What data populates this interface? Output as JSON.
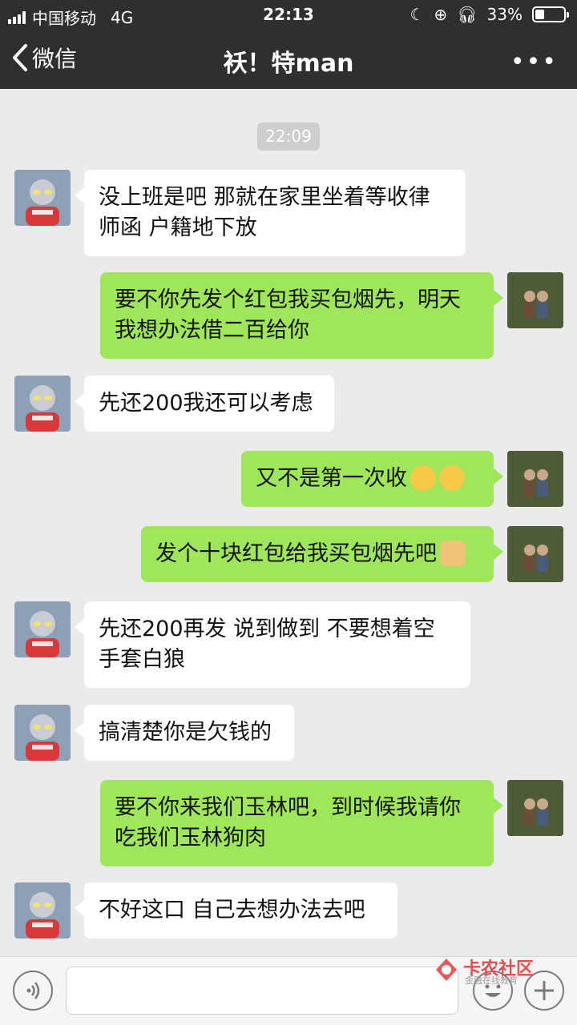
{
  "status_bar": {
    "carrier": "中国移动",
    "network": "4G",
    "time": "22:13",
    "battery": "33%",
    "battery_level": 0.33
  },
  "nav": {
    "back_label": "微信",
    "title": "袄！特man"
  },
  "chat": {
    "timestamp": "22:09",
    "messages": [
      {
        "side": "in",
        "text": "没上班是吧 那就在家里坐着等收律师函 户籍地下放"
      },
      {
        "side": "out",
        "text": "要不你先发个红包我买包烟先，明天我想办法借二百给你"
      },
      {
        "side": "in",
        "text": "先还200我还可以考虑"
      },
      {
        "side": "out",
        "text": "又不是第一次收"
      },
      {
        "side": "out",
        "text": "发个十块红包给我买包烟先吧"
      },
      {
        "side": "in",
        "text": "先还200再发 说到做到 不要想着空手套白狼"
      },
      {
        "side": "in",
        "text": "搞清楚你是欠钱的"
      },
      {
        "side": "out",
        "text": "要不你来我们玉林吧，到时候我请你吃我们玉林狗肉"
      },
      {
        "side": "in",
        "text": "不好这口 自己去想办法去吧"
      }
    ]
  },
  "watermark": {
    "title": "卡农社区",
    "subtitle": "金融在线教育"
  }
}
